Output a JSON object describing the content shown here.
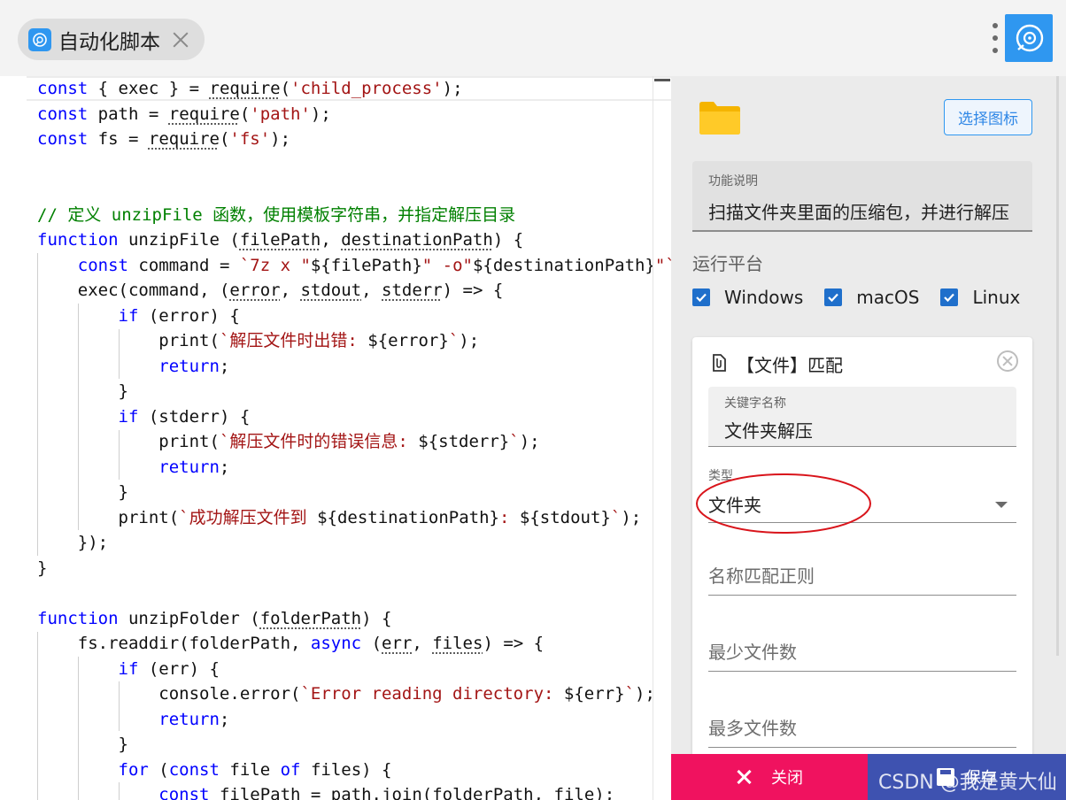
{
  "tab": {
    "label": "自动化脚本",
    "icon": "robot-face-icon"
  },
  "colors": {
    "accent": "#2f97f0",
    "close_button": "#f0125f",
    "save_button": "#3e52b0",
    "keyword": "#0000ff",
    "string": "#a31515",
    "comment": "#008000"
  },
  "code_lines": [
    [
      [
        "kw",
        "const"
      ],
      [
        "pn",
        " { "
      ],
      [
        "id",
        "exec"
      ],
      [
        "pn",
        " } = "
      ],
      [
        "sq",
        "require"
      ],
      [
        "pn",
        "("
      ],
      [
        "str",
        "'child_process'"
      ],
      [
        "pn",
        ");"
      ]
    ],
    [
      [
        "kw",
        "const"
      ],
      [
        "pn",
        " "
      ],
      [
        "id",
        "path"
      ],
      [
        "pn",
        " = "
      ],
      [
        "sq",
        "require"
      ],
      [
        "pn",
        "("
      ],
      [
        "str",
        "'path'"
      ],
      [
        "pn",
        ");"
      ]
    ],
    [
      [
        "kw",
        "const"
      ],
      [
        "pn",
        " "
      ],
      [
        "id",
        "fs"
      ],
      [
        "pn",
        " = "
      ],
      [
        "sq",
        "require"
      ],
      [
        "pn",
        "("
      ],
      [
        "str",
        "'fs'"
      ],
      [
        "pn",
        ");"
      ]
    ],
    [],
    [],
    [
      [
        "cm",
        "// 定义 unzipFile 函数，使用模板字符串，并指定解压目录"
      ]
    ],
    [
      [
        "kw",
        "function"
      ],
      [
        "pn",
        " "
      ],
      [
        "id",
        "unzipFile"
      ],
      [
        "pn",
        " ("
      ],
      [
        "sq",
        "filePath"
      ],
      [
        "pn",
        ", "
      ],
      [
        "sq",
        "destinationPath"
      ],
      [
        "pn",
        ") {"
      ]
    ],
    [
      [
        "pn",
        "    "
      ],
      [
        "kw",
        "const"
      ],
      [
        "pn",
        " "
      ],
      [
        "id",
        "command"
      ],
      [
        "pn",
        " = "
      ],
      [
        "str",
        "`7z x \""
      ],
      [
        "pn",
        "${"
      ],
      [
        "id",
        "filePath"
      ],
      [
        "pn",
        "}"
      ],
      [
        "str",
        "\" -o\""
      ],
      [
        "pn",
        "${"
      ],
      [
        "id",
        "destinationPath"
      ],
      [
        "pn",
        "}"
      ],
      [
        "str",
        "\"`"
      ]
    ],
    [
      [
        "pn",
        "    "
      ],
      [
        "id",
        "exec"
      ],
      [
        "pn",
        "("
      ],
      [
        "id",
        "command"
      ],
      [
        "pn",
        ", ("
      ],
      [
        "sq",
        "error"
      ],
      [
        "pn",
        ", "
      ],
      [
        "sq",
        "stdout"
      ],
      [
        "pn",
        ", "
      ],
      [
        "sq",
        "stderr"
      ],
      [
        "pn",
        ") => {"
      ]
    ],
    [
      [
        "pn",
        "        "
      ],
      [
        "kw",
        "if"
      ],
      [
        "pn",
        " ("
      ],
      [
        "id",
        "error"
      ],
      [
        "pn",
        ") {"
      ]
    ],
    [
      [
        "pn",
        "            "
      ],
      [
        "id",
        "print"
      ],
      [
        "pn",
        "("
      ],
      [
        "str",
        "`解压文件时出错: "
      ],
      [
        "pn",
        "${"
      ],
      [
        "id",
        "error"
      ],
      [
        "pn",
        "}"
      ],
      [
        "str",
        "`"
      ],
      [
        "pn",
        ");"
      ]
    ],
    [
      [
        "pn",
        "            "
      ],
      [
        "kw",
        "return"
      ],
      [
        "pn",
        ";"
      ]
    ],
    [
      [
        "pn",
        "        }"
      ]
    ],
    [
      [
        "pn",
        "        "
      ],
      [
        "kw",
        "if"
      ],
      [
        "pn",
        " ("
      ],
      [
        "id",
        "stderr"
      ],
      [
        "pn",
        ") {"
      ]
    ],
    [
      [
        "pn",
        "            "
      ],
      [
        "id",
        "print"
      ],
      [
        "pn",
        "("
      ],
      [
        "str",
        "`解压文件时的错误信息: "
      ],
      [
        "pn",
        "${"
      ],
      [
        "id",
        "stderr"
      ],
      [
        "pn",
        "}"
      ],
      [
        "str",
        "`"
      ],
      [
        "pn",
        ");"
      ]
    ],
    [
      [
        "pn",
        "            "
      ],
      [
        "kw",
        "return"
      ],
      [
        "pn",
        ";"
      ]
    ],
    [
      [
        "pn",
        "        }"
      ]
    ],
    [
      [
        "pn",
        "        "
      ],
      [
        "id",
        "print"
      ],
      [
        "pn",
        "("
      ],
      [
        "str",
        "`成功解压文件到 "
      ],
      [
        "pn",
        "${"
      ],
      [
        "id",
        "destinationPath"
      ],
      [
        "pn",
        "}"
      ],
      [
        "str",
        ": "
      ],
      [
        "pn",
        "${"
      ],
      [
        "id",
        "stdout"
      ],
      [
        "pn",
        "}"
      ],
      [
        "str",
        "`"
      ],
      [
        "pn",
        ");"
      ]
    ],
    [
      [
        "pn",
        "    });"
      ]
    ],
    [
      [
        "pn",
        "}"
      ]
    ],
    [],
    [
      [
        "kw",
        "function"
      ],
      [
        "pn",
        " "
      ],
      [
        "id",
        "unzipFolder"
      ],
      [
        "pn",
        " ("
      ],
      [
        "sq",
        "folderPath"
      ],
      [
        "pn",
        ") {"
      ]
    ],
    [
      [
        "pn",
        "    "
      ],
      [
        "id",
        "fs"
      ],
      [
        "pn",
        "."
      ],
      [
        "id",
        "readdir"
      ],
      [
        "pn",
        "("
      ],
      [
        "id",
        "folderPath"
      ],
      [
        "pn",
        ", "
      ],
      [
        "kw",
        "async"
      ],
      [
        "pn",
        " ("
      ],
      [
        "sq",
        "err"
      ],
      [
        "pn",
        ", "
      ],
      [
        "sq",
        "files"
      ],
      [
        "pn",
        ") => {"
      ]
    ],
    [
      [
        "pn",
        "        "
      ],
      [
        "kw",
        "if"
      ],
      [
        "pn",
        " ("
      ],
      [
        "id",
        "err"
      ],
      [
        "pn",
        ") {"
      ]
    ],
    [
      [
        "pn",
        "            "
      ],
      [
        "id",
        "console"
      ],
      [
        "pn",
        "."
      ],
      [
        "id",
        "error"
      ],
      [
        "pn",
        "("
      ],
      [
        "str",
        "`Error reading directory: "
      ],
      [
        "pn",
        "${"
      ],
      [
        "id",
        "err"
      ],
      [
        "pn",
        "}"
      ],
      [
        "str",
        "`"
      ],
      [
        "pn",
        ");"
      ]
    ],
    [
      [
        "pn",
        "            "
      ],
      [
        "kw",
        "return"
      ],
      [
        "pn",
        ";"
      ]
    ],
    [
      [
        "pn",
        "        }"
      ]
    ],
    [
      [
        "pn",
        "        "
      ],
      [
        "kw",
        "for"
      ],
      [
        "pn",
        " ("
      ],
      [
        "kw",
        "const"
      ],
      [
        "pn",
        " "
      ],
      [
        "id",
        "file"
      ],
      [
        "pn",
        " "
      ],
      [
        "kw",
        "of"
      ],
      [
        "pn",
        " "
      ],
      [
        "id",
        "files"
      ],
      [
        "pn",
        ") {"
      ]
    ],
    [
      [
        "pn",
        "            "
      ],
      [
        "kw",
        "const"
      ],
      [
        "pn",
        " "
      ],
      [
        "id",
        "filePath"
      ],
      [
        "pn",
        " = "
      ],
      [
        "id",
        "path"
      ],
      [
        "pn",
        "."
      ],
      [
        "id",
        "join"
      ],
      [
        "pn",
        "("
      ],
      [
        "id",
        "folderPath"
      ],
      [
        "pn",
        ", "
      ],
      [
        "id",
        "file"
      ],
      [
        "pn",
        ");"
      ]
    ]
  ],
  "panel": {
    "choose_icon_label": "选择图标",
    "description": {
      "label": "功能说明",
      "value": "扫描文件夹里面的压缩包，并进行解压"
    },
    "platform": {
      "title": "运行平台",
      "options": [
        {
          "label": "Windows",
          "checked": true
        },
        {
          "label": "macOS",
          "checked": true
        },
        {
          "label": "Linux",
          "checked": true
        }
      ]
    },
    "card": {
      "title": "【文件】匹配",
      "keyword": {
        "label": "关键字名称",
        "value": "文件夹解压"
      },
      "type": {
        "label": "类型",
        "value": "文件夹"
      },
      "regex_placeholder": "名称匹配正则",
      "min_files_placeholder": "最少文件数",
      "max_files_placeholder": "最多文件数"
    },
    "close_label": "关闭",
    "save_label": "保存"
  },
  "watermark": "CSDN @我是黄大仙"
}
